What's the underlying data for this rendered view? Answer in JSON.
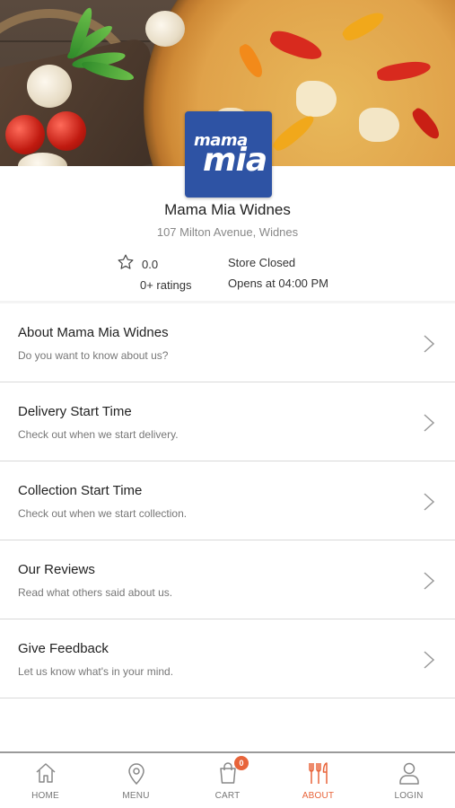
{
  "store": {
    "logo_line1": "mama",
    "logo_line2": "mia",
    "name": "Mama Mia Widnes",
    "address": "107 Milton Avenue, Widnes",
    "rating": "0.0",
    "ratings_count": "0+ ratings",
    "status": "Store Closed",
    "hours": "Opens at 04:00 PM"
  },
  "menu": {
    "items": [
      {
        "title": "About Mama Mia Widnes",
        "subtitle": "Do you want to know about us?"
      },
      {
        "title": "Delivery Start Time",
        "subtitle": "Check out when we start delivery."
      },
      {
        "title": "Collection Start Time",
        "subtitle": "Check out when we start collection."
      },
      {
        "title": "Our Reviews",
        "subtitle": "Read what others said about us."
      },
      {
        "title": "Give Feedback",
        "subtitle": "Let us know what's in your mind."
      }
    ]
  },
  "nav": {
    "items": [
      {
        "label": "HOME",
        "icon": "home-icon"
      },
      {
        "label": "MENU",
        "icon": "location-pin-icon"
      },
      {
        "label": "CART",
        "icon": "shopping-bag-icon",
        "badge": "0"
      },
      {
        "label": "ABOUT",
        "icon": "utensils-icon",
        "active": true
      },
      {
        "label": "LOGIN",
        "icon": "user-icon"
      }
    ]
  },
  "colors": {
    "accent": "#e8643a",
    "logo_bg": "#2e53a4"
  }
}
